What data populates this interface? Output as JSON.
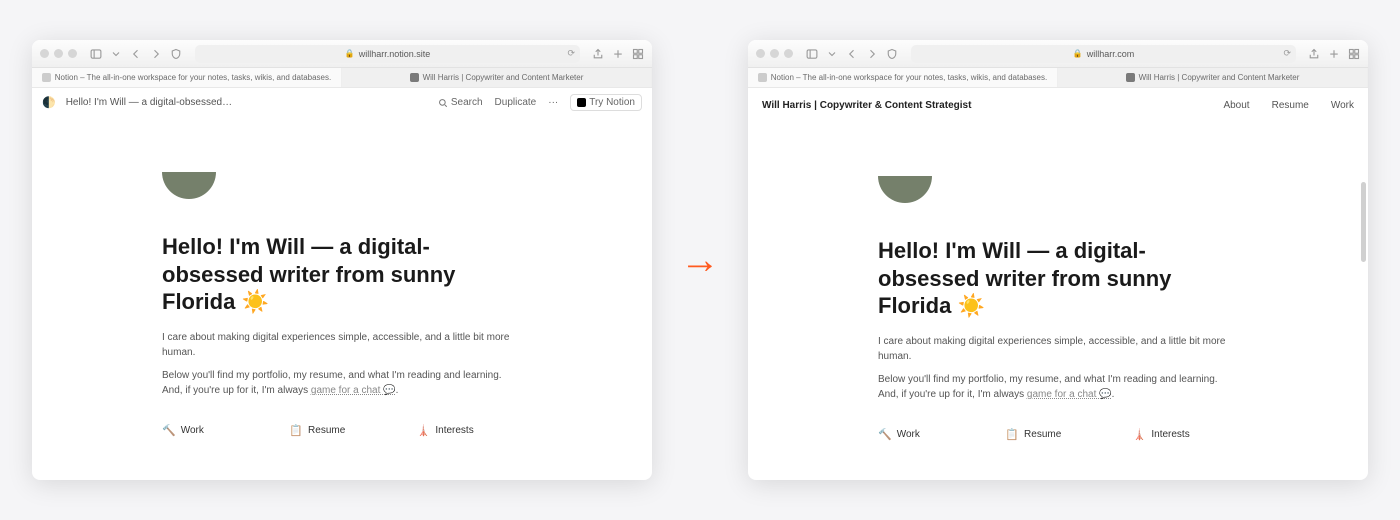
{
  "left": {
    "url": "willharr.notion.site",
    "tabs": [
      {
        "label": "Notion – The all-in-one workspace for your notes, tasks, wikis, and databases.",
        "active": false
      },
      {
        "label": "Will Harris | Copywriter and Content Marketer",
        "active": true
      }
    ],
    "notion_bar": {
      "emoji": "🌓",
      "breadcrumb": "Hello! I'm Will — a digital-obsessed…",
      "search": "Search",
      "duplicate": "Duplicate",
      "more": "···",
      "try": "Try Notion"
    }
  },
  "right": {
    "url": "willharr.com",
    "tabs": [
      {
        "label": "Notion – The all-in-one workspace for your notes, tasks, wikis, and databases.",
        "active": false
      },
      {
        "label": "Will Harris | Copywriter and Content Marketer",
        "active": true
      }
    ],
    "nav": {
      "brand": "Will Harris | Copywriter & Content Strategist",
      "links": [
        "About",
        "Resume",
        "Work"
      ]
    }
  },
  "page": {
    "headline": "Hello! I'm Will — a digital-obsessed writer from sunny Florida ☀️",
    "para1": "I care about making digital experiences simple, accessible, and a little bit more human.",
    "para2_a": "Below you'll find my portfolio, my resume, and what I'm reading and learning. And, if you're up for it, I'm always ",
    "para2_link": "game for a chat 💬",
    "para2_b": ".",
    "cards": [
      {
        "icon": "🔨",
        "label": "Work"
      },
      {
        "icon": "📋",
        "label": "Resume"
      },
      {
        "icon": "🗼",
        "label": "Interests"
      }
    ]
  }
}
